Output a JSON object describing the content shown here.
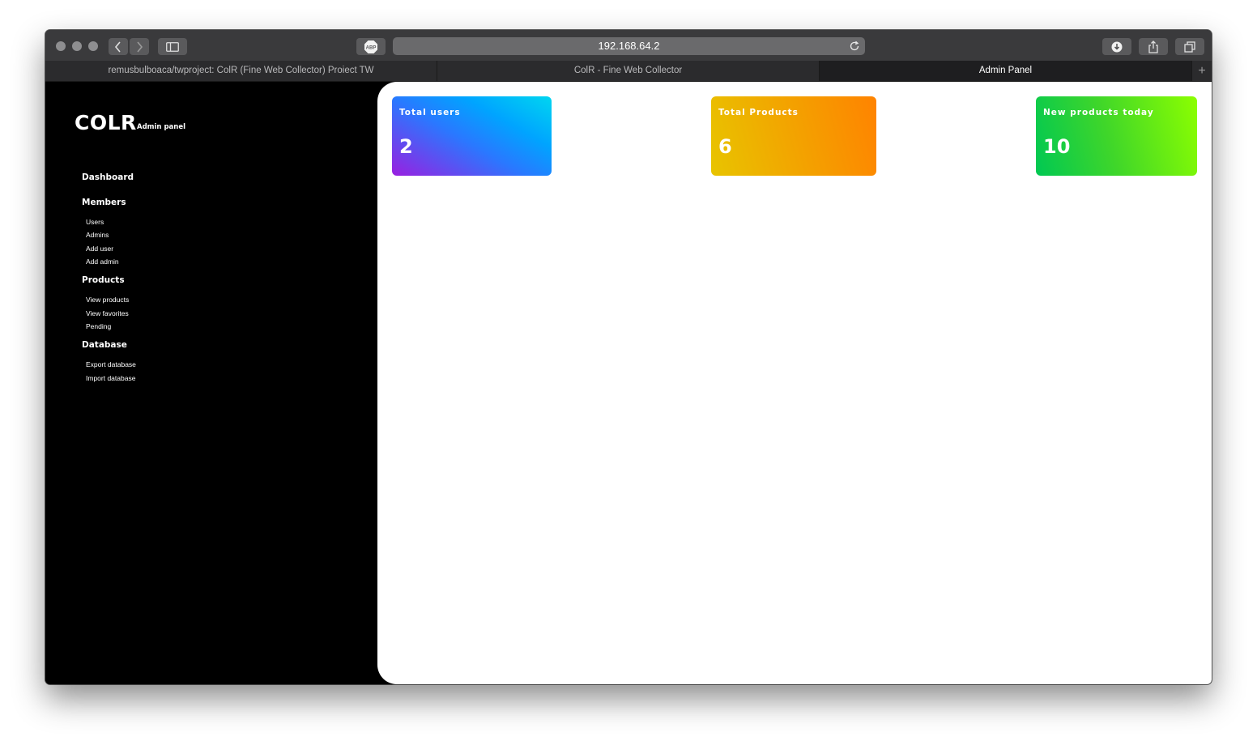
{
  "browser": {
    "url": "192.168.64.2",
    "adblock_label": "ABP",
    "tabs": [
      {
        "title": "remusbulboaca/twproject: ColR (Fine Web Collector) Proiect TW",
        "active": false
      },
      {
        "title": "ColR - Fine Web Collector",
        "active": false
      },
      {
        "title": "Admin Panel",
        "active": true
      }
    ],
    "new_tab_label": "+"
  },
  "sidebar": {
    "logo": "COLR",
    "logo_sub": "Admin panel",
    "dashboard_label": "Dashboard",
    "sections": [
      {
        "heading": "Members",
        "items": [
          "Users",
          "Admins",
          "Add user",
          "Add admin"
        ]
      },
      {
        "heading": "Products",
        "items": [
          "View products",
          "View favorites",
          "Pending"
        ]
      },
      {
        "heading": "Database",
        "items": [
          "Export database",
          "Import database"
        ]
      }
    ]
  },
  "cards": [
    {
      "title": "Total users",
      "value": "2"
    },
    {
      "title": "Total Products",
      "value": "6"
    },
    {
      "title": "New products today",
      "value": "10"
    }
  ]
}
